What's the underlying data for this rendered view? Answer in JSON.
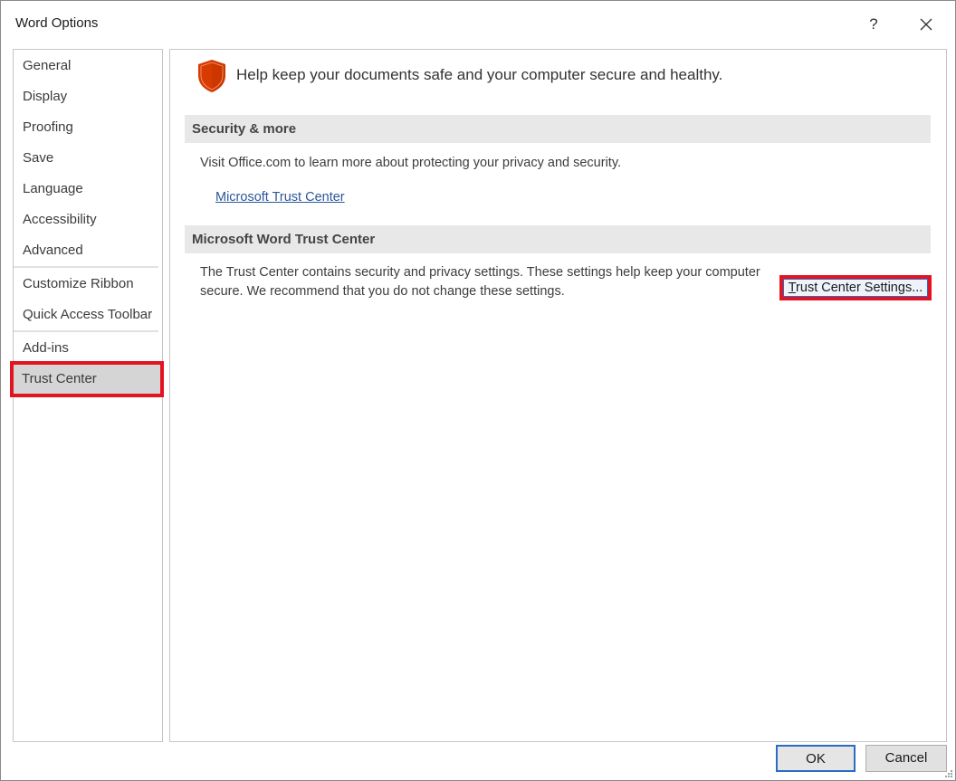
{
  "window": {
    "title": "Word Options",
    "help_label": "?"
  },
  "sidebar": {
    "items": [
      {
        "label": "General"
      },
      {
        "label": "Display"
      },
      {
        "label": "Proofing"
      },
      {
        "label": "Save"
      },
      {
        "label": "Language"
      },
      {
        "label": "Accessibility"
      },
      {
        "label": "Advanced"
      },
      {
        "label": "Customize Ribbon"
      },
      {
        "label": "Quick Access Toolbar"
      },
      {
        "label": "Add-ins"
      },
      {
        "label": "Trust Center",
        "selected": true
      }
    ]
  },
  "main": {
    "headline": "Help keep your documents safe and your computer secure and healthy.",
    "security_section": {
      "title": "Security & more",
      "text": "Visit Office.com to learn more about protecting your privacy and security.",
      "link_label": "Microsoft Trust Center"
    },
    "trust_section": {
      "title": "Microsoft Word Trust Center",
      "text_line1": "The Trust Center contains security and privacy settings. These settings help keep your computer",
      "text_line2": "secure. We recommend that you do not change these settings.",
      "button_label_accel": "T",
      "button_label_rest": "rust Center Settings..."
    }
  },
  "footer": {
    "ok_label": "OK",
    "cancel_label": "Cancel"
  },
  "colors": {
    "highlight": "#e3141f",
    "shield": "#d83b01",
    "link": "#2b579a"
  }
}
